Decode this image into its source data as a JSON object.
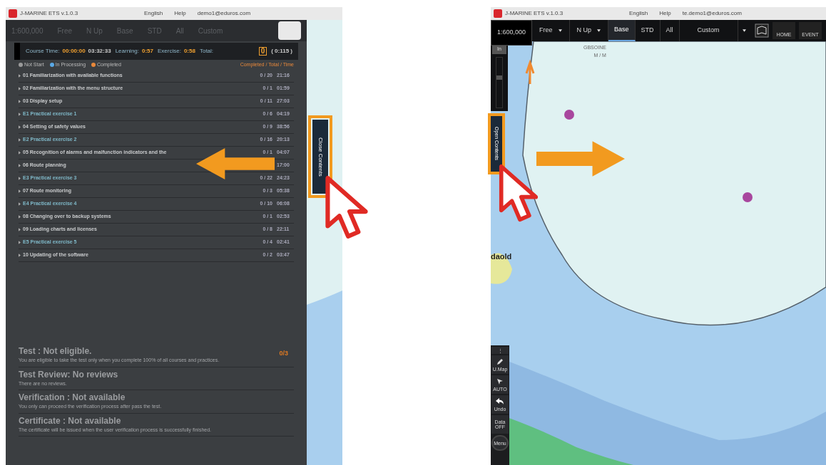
{
  "left_screen": {
    "title_bar": {
      "app_name": "J-MARINE ETS v.1.0.3",
      "links": [
        "English",
        "Help",
        "demo1@eduros.com"
      ]
    },
    "faint_toolbar": [
      "1:600,000",
      "Free",
      "N Up",
      "Base",
      "STD",
      "All",
      "Custom"
    ],
    "stats": [
      {
        "label": "Course Time:",
        "values": [
          "00:00:00",
          "03:32:33"
        ]
      },
      {
        "label": "Learning:",
        "values": [
          "0:57"
        ]
      },
      {
        "label": "Exercise:",
        "values": [
          "0:58"
        ]
      },
      {
        "label": "Total:"
      }
    ],
    "total_box": "0",
    "total_rest": "( 0:115 )",
    "legend": [
      {
        "label": "Not Start",
        "color": "#9a9a9a"
      },
      {
        "label": "In Processing",
        "color": "#5aa9e6"
      },
      {
        "label": "Completed",
        "color": "#e8883a"
      }
    ],
    "legend_right": "Completed / Total / Time",
    "lessons": [
      {
        "kind": "course",
        "title": "01 Familiarization with available functions",
        "count": "0 / 20",
        "time": "21:16"
      },
      {
        "kind": "course",
        "title": "02 Familiarization with the menu structure",
        "count": "0 / 1",
        "time": "01:59"
      },
      {
        "kind": "course",
        "title": "03 Display setup",
        "count": "0 / 11",
        "time": "27:03"
      },
      {
        "kind": "exercise",
        "title": "E1 Practical exercise 1",
        "count": "0 / 6",
        "time": "04:19"
      },
      {
        "kind": "course",
        "title": "04 Setting of safety values",
        "count": "0 / 9",
        "time": "38:56"
      },
      {
        "kind": "exercise",
        "title": "E2 Practical exercise 2",
        "count": "0 / 16",
        "time": "20:13"
      },
      {
        "kind": "course",
        "title": "05 Recognition of alarms and malfunction indicators and the",
        "count": "0 / 1",
        "time": "04:07"
      },
      {
        "kind": "course",
        "title": "06 Route planning",
        "time": "17:00"
      },
      {
        "kind": "exercise",
        "title": "E3 Practical exercise 3",
        "count": "0 / 22",
        "time": "24:23"
      },
      {
        "kind": "course",
        "title": "07 Route monitoring",
        "count": "0 / 3",
        "time": "05:38"
      },
      {
        "kind": "exercise",
        "title": "E4 Practical exercise 4",
        "count": "0 / 10",
        "time": "06:08"
      },
      {
        "kind": "course",
        "title": "08 Changing over to backup systems",
        "count": "0 / 1",
        "time": "02:53"
      },
      {
        "kind": "course",
        "title": "09 Loading charts and licenses",
        "count": "0 / 8",
        "time": "22:11"
      },
      {
        "kind": "exercise",
        "title": "E5 Practical exercise 5",
        "count": "0 / 4",
        "time": "02:41"
      },
      {
        "kind": "course",
        "title": "10 Updating of the software",
        "count": "0 / 2",
        "time": "03:47"
      }
    ],
    "sections": [
      {
        "title": "Test : Not eligible.",
        "note": "You are eligible to take the test only when you complete 100% of all courses and practices.",
        "score": "0/3"
      },
      {
        "title": "Test Review: No reviews",
        "note": "There are no reviews."
      },
      {
        "title": "Verification : Not available",
        "note": "You only can proceed the verification process after pass the test."
      },
      {
        "title": "Certificate : Not available",
        "note": "The certificate will be issued when the user verification process is successfully finished."
      }
    ],
    "side_tab": "Close Contents"
  },
  "right_screen": {
    "title_bar": {
      "app_name": "J-MARINE ETS v.1.0.3",
      "links": [
        "English",
        "Help",
        "te.demo1@eduros.com"
      ]
    },
    "scale": "1:600,000",
    "toolbar": [
      {
        "kind": "dropdown",
        "label": "Free"
      },
      {
        "kind": "dropdown",
        "label": "N Up"
      },
      {
        "kind": "tab",
        "label": "Base",
        "selected": true
      },
      {
        "kind": "tab",
        "label": "STD",
        "selected": false
      },
      {
        "kind": "tab",
        "label": "All",
        "selected": false
      },
      {
        "kind": "wide",
        "label": "Custom"
      }
    ],
    "icon_buttons": [
      {
        "kind": "chart"
      },
      {
        "kind": "home",
        "label": "HOME"
      },
      {
        "kind": "event",
        "label": "EVENT"
      }
    ],
    "zoom_in": "In",
    "zoom_slider": {
      "level": 0.6
    },
    "side_tab": "Open Contents",
    "map_labels": [
      "GBSOINE",
      "M / M"
    ],
    "place_label": "daold",
    "tools": [
      {
        "kind": "more",
        "label": "⋮"
      },
      {
        "kind": "pencil",
        "label": "U.Map"
      },
      {
        "kind": "pointer",
        "label": "AUTO"
      },
      {
        "kind": "undo",
        "label": "Undo"
      },
      {
        "kind": "text",
        "label": "Data OFF"
      },
      {
        "kind": "round",
        "label": "Menu"
      }
    ]
  }
}
